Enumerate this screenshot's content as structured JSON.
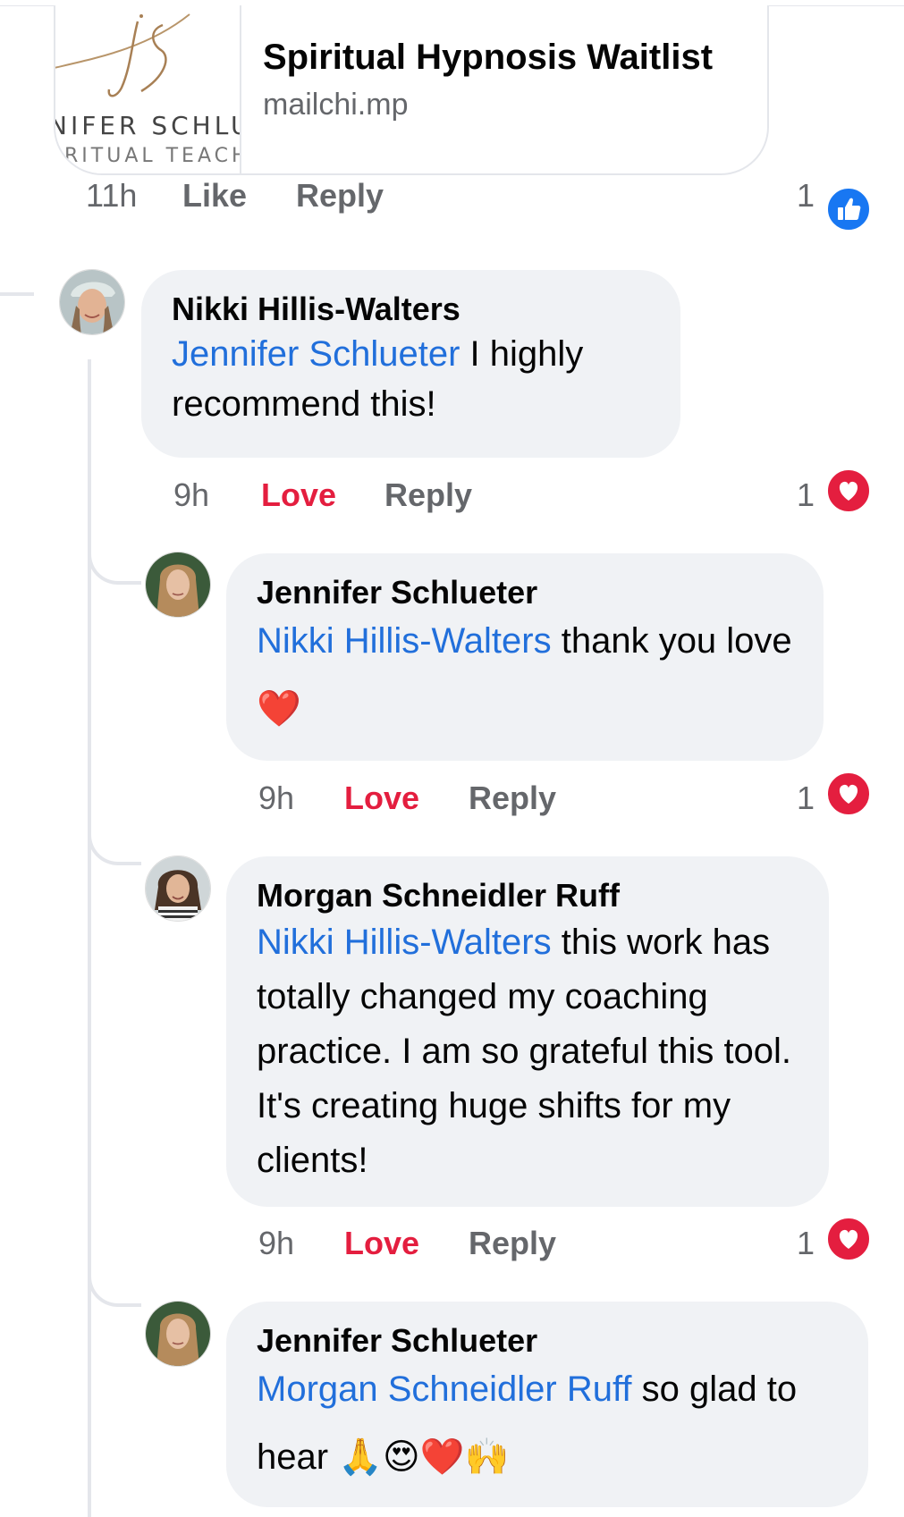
{
  "link_preview": {
    "thumb_monogram": "js",
    "thumb_line1": "NIFER SCHLU",
    "thumb_line2": "RITUAL TEACH",
    "title": "Spiritual Hypnosis Waitlist",
    "domain": "mailchi.mp"
  },
  "parent_meta": {
    "time": "11h",
    "like": "Like",
    "reply": "Reply",
    "count": "1",
    "reaction": "like"
  },
  "comments": [
    {
      "author": "Nikki Hillis-Walters",
      "mention": "Jennifer Schlueter",
      "text": " I highly recommend this!",
      "time": "9h",
      "action": "Love",
      "reply": "Reply",
      "count": "1",
      "reaction": "love"
    },
    {
      "author": "Jennifer Schlueter",
      "mention": "Nikki Hillis-Walters",
      "text": " thank you love ",
      "emoji": "❤️",
      "time": "9h",
      "action": "Love",
      "reply": "Reply",
      "count": "1",
      "reaction": "love"
    },
    {
      "author": "Morgan Schneidler Ruff",
      "mention": "Nikki Hillis-Walters",
      "text": " this work has totally changed my coaching practice. I am so grateful this tool. It's creating huge shifts for my clients!",
      "time": "9h",
      "action": "Love",
      "reply": "Reply",
      "count": "1",
      "reaction": "love"
    },
    {
      "author": "Jennifer Schlueter",
      "mention": "Morgan Schneidler Ruff",
      "text": " so glad to hear ",
      "emoji": "🙏😍❤️🙌"
    }
  ],
  "colors": {
    "mention": "#216fdb",
    "love": "#e41e3f",
    "like_badge": "#1877f2",
    "bubble": "#f0f2f5",
    "meta": "#65676b"
  }
}
